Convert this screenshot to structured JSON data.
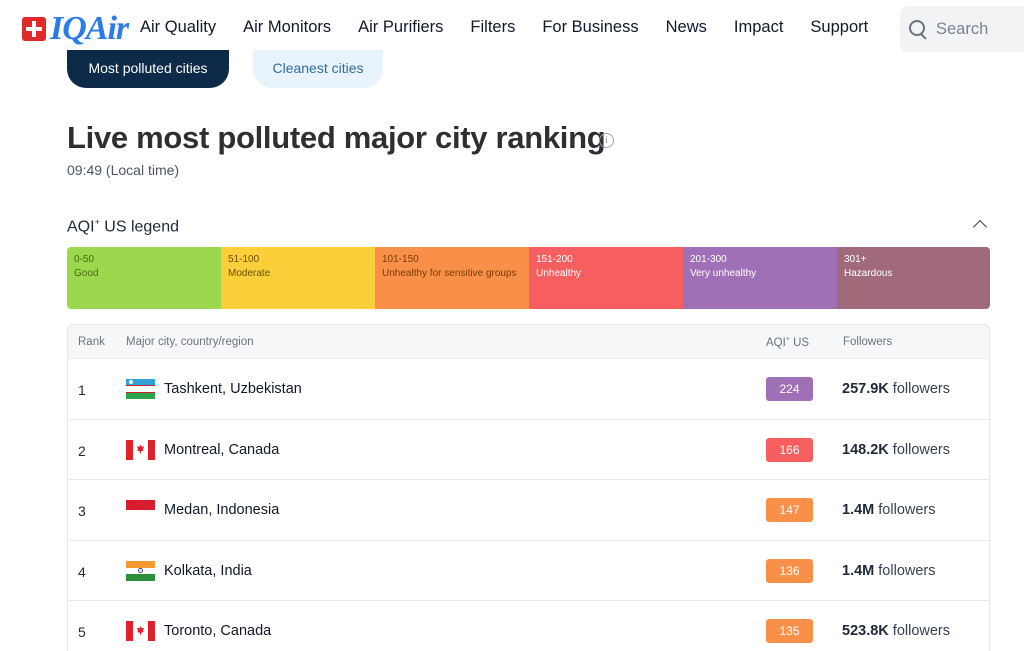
{
  "brand": {
    "logo_text": "IQAir"
  },
  "nav": {
    "items": [
      "Air Quality",
      "Air Monitors",
      "Air Purifiers",
      "Filters",
      "For Business",
      "News",
      "Impact",
      "Support"
    ]
  },
  "search": {
    "placeholder": "Search",
    "icon": "search-icon"
  },
  "tabs": {
    "primary": "Most polluted cities",
    "secondary": "Cleanest cities"
  },
  "page": {
    "title": "Live most polluted major city ranking",
    "local_time": "09:49 (Local time)"
  },
  "legend": {
    "title_prefix": "AQI",
    "title_sup": "+",
    "title_suffix": " US legend",
    "segments": [
      {
        "range": "0-50",
        "label": "Good",
        "color": "#9cd84e",
        "text_color": "#4a6a12"
      },
      {
        "range": "51-100",
        "label": "Moderate",
        "color": "#facf39",
        "text_color": "#6b5200"
      },
      {
        "range": "101-150",
        "label": "Unhealthy for sensitive groups",
        "color": "#f99049",
        "text_color": "#7a3a05"
      },
      {
        "range": "151-200",
        "label": "Unhealthy",
        "color": "#f65e5f",
        "text_color": "#ffffff"
      },
      {
        "range": "201-300",
        "label": "Very unhealthy",
        "color": "#a070b6",
        "text_color": "#ffffff"
      },
      {
        "range": "301+",
        "label": "Hazardous",
        "color": "#a06a7b",
        "text_color": "#ffffff"
      }
    ]
  },
  "table": {
    "headers": {
      "rank": "Rank",
      "city": "Major city, country/region",
      "aqi_prefix": "AQI",
      "aqi_sup": "+",
      "aqi_suffix": " US",
      "followers": "Followers"
    },
    "followers_suffix": " followers",
    "rows": [
      {
        "rank": "1",
        "flag": "uz",
        "city": "Tashkent, Uzbekistan",
        "aqi": "224",
        "aqi_color": "#a070b6",
        "followers": "257.9K"
      },
      {
        "rank": "2",
        "flag": "ca",
        "city": "Montreal, Canada",
        "aqi": "166",
        "aqi_color": "#f65e5f",
        "followers": "148.2K"
      },
      {
        "rank": "3",
        "flag": "id",
        "city": "Medan, Indonesia",
        "aqi": "147",
        "aqi_color": "#f99049",
        "followers": "1.4M"
      },
      {
        "rank": "4",
        "flag": "in",
        "city": "Kolkata, India",
        "aqi": "136",
        "aqi_color": "#f99049",
        "followers": "1.4M"
      },
      {
        "rank": "5",
        "flag": "ca",
        "city": "Toronto, Canada",
        "aqi": "135",
        "aqi_color": "#f99049",
        "followers": "523.8K"
      }
    ]
  }
}
